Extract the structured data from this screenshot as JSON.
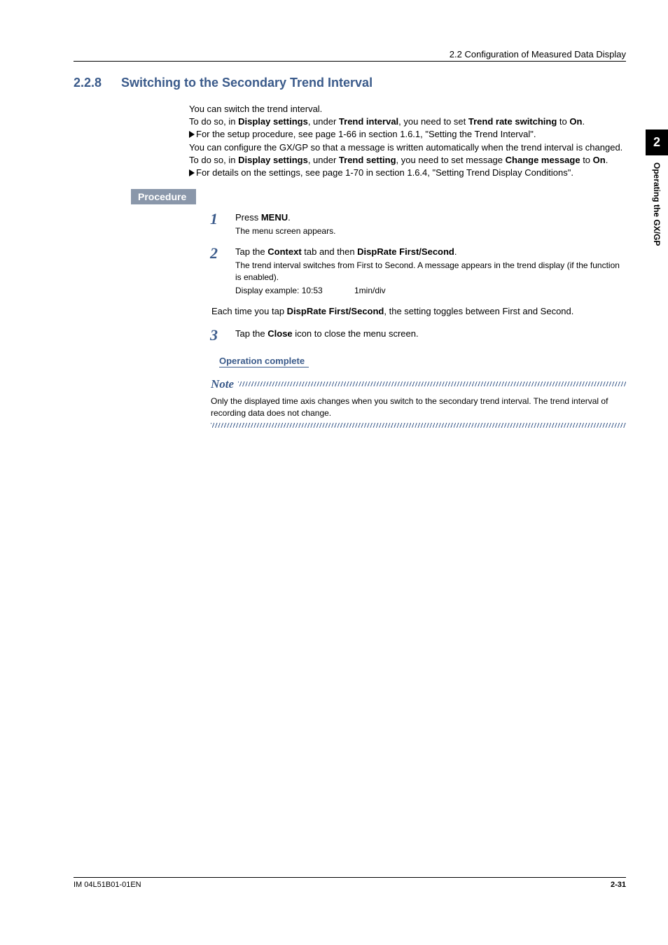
{
  "header": {
    "breadcrumb": "2.2  Configuration of Measured Data Display"
  },
  "section": {
    "number": "2.2.8",
    "title": "Switching to the Secondary Trend Interval"
  },
  "intro": {
    "p1": "You can switch the trend interval.",
    "p2a": "To do so, in ",
    "p2b": "Display settings",
    "p2c": ", under ",
    "p2d": "Trend interval",
    "p2e": ", you need to set ",
    "p2f": "Trend rate switching",
    "p2g": " to ",
    "p2h": "On",
    "p2i": ".",
    "p3": "For the setup procedure, see page 1-66 in section 1.6.1, \"Setting the Trend Interval\".",
    "p4a": "You can configure the GX/GP so that a message is written automatically when the trend interval is changed. To do so, in ",
    "p4b": "Display settings",
    "p4c": ", under ",
    "p4d": "Trend setting",
    "p4e": ", you need to set message ",
    "p4f": "Change message",
    "p4g": " to ",
    "p4h": "On",
    "p4i": ".",
    "p5": "For details on the settings, see page 1-70 in section 1.6.4, \"Setting Trend Display Conditions\"."
  },
  "procedure_label": "Procedure",
  "steps": {
    "s1": {
      "n": "1",
      "a": "Press ",
      "b": "MENU",
      "c": ".",
      "sub": "The menu screen appears."
    },
    "s2": {
      "n": "2",
      "a": "Tap the ",
      "b": "Context",
      "c": " tab and then ",
      "d": "DispRate First/Second",
      "e": ".",
      "sub1": "The trend interval switches from First to Second. A message appears in the trend display (if the function is enabled).",
      "sub2a": " Display example: 10:53",
      "sub2b": "1min/div"
    },
    "mid_a": "Each time you tap ",
    "mid_b": "DispRate First/Second",
    "mid_c": ", the setting toggles between First and Second.",
    "s3": {
      "n": "3",
      "a": "Tap the ",
      "b": "Close",
      "c": " icon to close the menu screen."
    }
  },
  "op_complete": "Operation complete",
  "note": {
    "title": "Note",
    "body": "Only the displayed time axis changes when you switch to the secondary trend interval. The trend interval of recording data does not change."
  },
  "side": {
    "chapter": "2",
    "label": "Operating the GX/GP"
  },
  "footer": {
    "left": "IM 04L51B01-01EN",
    "right": "2-31"
  }
}
